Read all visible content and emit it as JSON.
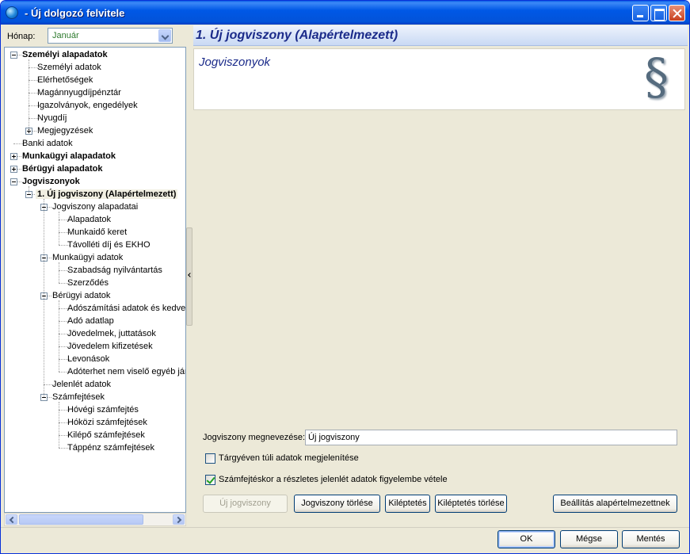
{
  "window": {
    "title": "- Új dolgozó felvitele"
  },
  "month": {
    "label": "Hónap:",
    "value": "Január"
  },
  "tree": [
    {
      "label": "Személyi alapadatok",
      "level": 0,
      "bold": true,
      "toggle": "minus"
    },
    {
      "label": "Személyi adatok",
      "level": 1
    },
    {
      "label": "Elérhetőségek",
      "level": 1
    },
    {
      "label": "Magánnyugdíjpénztár",
      "level": 1
    },
    {
      "label": "Igazolványok, engedélyek",
      "level": 1
    },
    {
      "label": "Nyugdíj",
      "level": 1
    },
    {
      "label": "Megjegyzések",
      "level": 1,
      "toggle": "plus"
    },
    {
      "label": "Banki adatok",
      "level": 0
    },
    {
      "label": "Munkaügyi alapadatok",
      "level": 0,
      "bold": true,
      "toggle": "plus"
    },
    {
      "label": "Bérügyi alapadatok",
      "level": 0,
      "bold": true,
      "toggle": "plus"
    },
    {
      "label": "Jogviszonyok",
      "level": 0,
      "bold": true,
      "toggle": "minus"
    },
    {
      "label": "1. Új jogviszony (Alapértelmezett)",
      "level": 1,
      "selected": true,
      "toggle": "minus"
    },
    {
      "label": "Jogviszony alapadatai",
      "level": 2,
      "toggle": "minus"
    },
    {
      "label": "Alapadatok",
      "level": 3
    },
    {
      "label": "Munkaidő keret",
      "level": 3
    },
    {
      "label": "Távolléti díj és EKHO",
      "level": 3
    },
    {
      "label": "Munkaügyi adatok",
      "level": 2,
      "toggle": "minus"
    },
    {
      "label": "Szabadság nyilvántartás",
      "level": 3
    },
    {
      "label": "Szerződés",
      "level": 3
    },
    {
      "label": "Bérügyi adatok",
      "level": 2,
      "toggle": "minus"
    },
    {
      "label": "Adószámítási adatok és kedvezmények",
      "level": 3
    },
    {
      "label": "Adó adatlap",
      "level": 3
    },
    {
      "label": "Jövedelmek, juttatások",
      "level": 3
    },
    {
      "label": "Jövedelem kifizetések",
      "level": 3
    },
    {
      "label": "Levonások",
      "level": 3
    },
    {
      "label": "Adóterhet nem viselő egyéb járandóságok",
      "level": 3
    },
    {
      "label": "Jelenlét adatok",
      "level": 2
    },
    {
      "label": "Számfejtések",
      "level": 2,
      "toggle": "minus"
    },
    {
      "label": "Hóvégi számfejtés",
      "level": 3
    },
    {
      "label": "Hóközi számfejtések",
      "level": 3
    },
    {
      "label": "Kilépő számfejtések",
      "level": 3
    },
    {
      "label": "Táppénz számfejtések",
      "level": 3
    }
  ],
  "header": {
    "title": "1. Új jogviszony (Alapértelmezett)"
  },
  "section": {
    "title": "Jogviszonyok",
    "icon": "section-sign-icon",
    "icon_glyph": "§"
  },
  "form": {
    "name_label": "Jogviszony megnevezése:",
    "name_value": "Új jogviszony",
    "chk_out_of_year": {
      "label": "Tárgyéven túli adatok megjelenítése",
      "checked": false
    },
    "chk_detailed_attendance": {
      "label": "Számfejtéskor a részletes jelenlét adatok figyelembe vétele",
      "checked": true
    }
  },
  "buttons": {
    "new": "Új jogviszony",
    "delete": "Jogviszony törlése",
    "exit": "Kiléptetés",
    "exit_delete": "Kiléptetés törlése",
    "set_default": "Beállítás alapértelmezettnek"
  },
  "footer": {
    "ok": "OK",
    "cancel": "Mégse",
    "save": "Mentés"
  }
}
